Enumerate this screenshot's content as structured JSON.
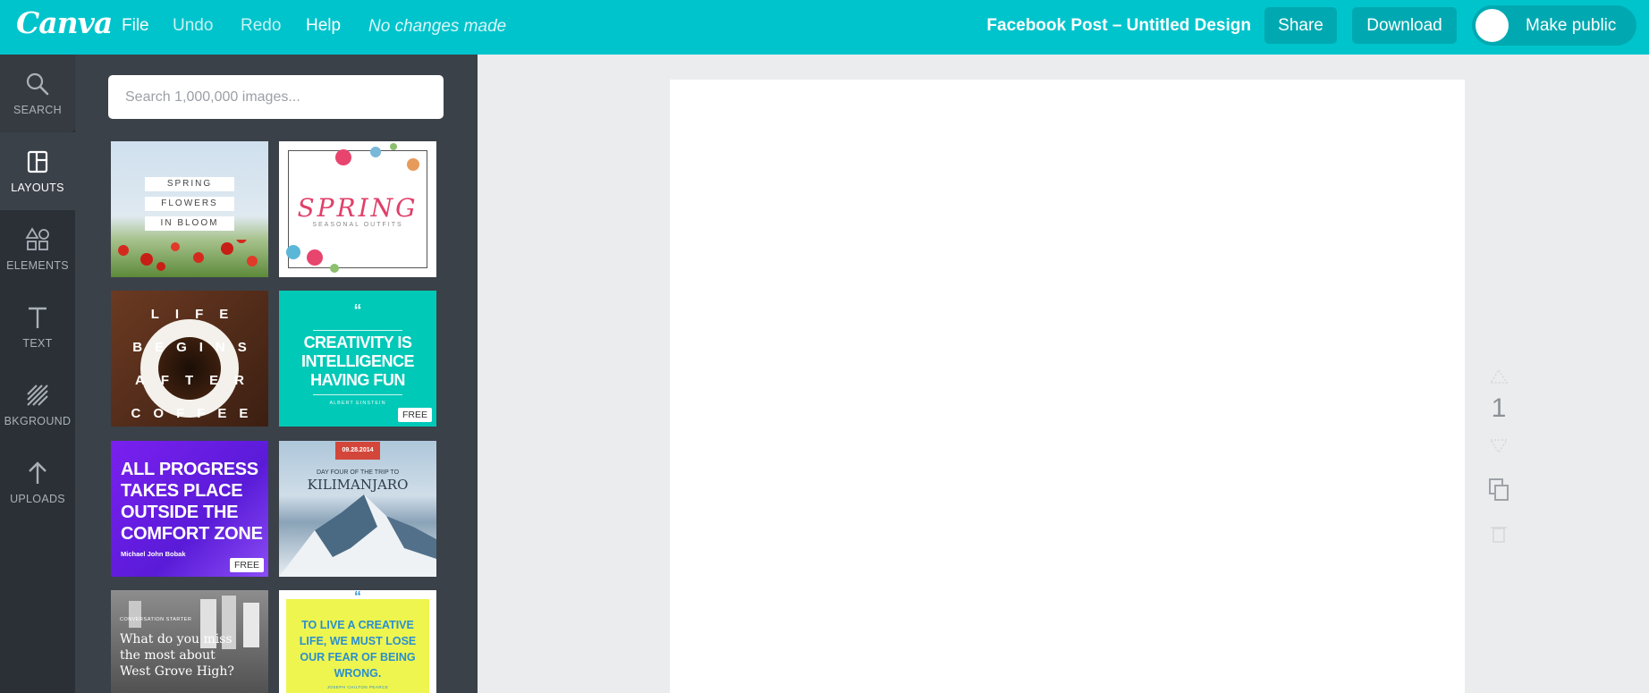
{
  "app": {
    "logo_text": "Canva"
  },
  "menu": {
    "file": "File",
    "undo": "Undo",
    "redo": "Redo",
    "help": "Help"
  },
  "status": "No changes made",
  "document_title": "Facebook Post – Untitled Design",
  "buttons": {
    "share": "Share",
    "download": "Download",
    "make_public": "Make public"
  },
  "sidebar": {
    "items": [
      {
        "label": "SEARCH",
        "icon": "search-icon"
      },
      {
        "label": "LAYOUTS",
        "icon": "layouts-icon",
        "selected": true
      },
      {
        "label": "ELEMENTS",
        "icon": "elements-icon"
      },
      {
        "label": "TEXT",
        "icon": "text-icon"
      },
      {
        "label": "BKGROUND",
        "icon": "background-icon"
      },
      {
        "label": "UPLOADS",
        "icon": "upload-icon"
      }
    ]
  },
  "panel": {
    "search_placeholder": "Search 1,000,000 images...",
    "layouts": [
      {
        "lines": [
          "SPRING",
          "FLOWERS",
          "IN BLOOM"
        ]
      },
      {
        "title": "SPRING",
        "subtitle": "SEASONAL OUTFITS"
      },
      {
        "letters": [
          "L",
          "I",
          "F",
          "E",
          "B",
          "E",
          "G",
          "I",
          "N",
          "S",
          "A",
          "F",
          "T",
          "E",
          "R",
          "C",
          "O",
          "F",
          "F",
          "E",
          "E"
        ]
      },
      {
        "quote_mark": "“",
        "lines": [
          "CREATIVITY IS",
          "INTELLIGENCE",
          "HAVING FUN"
        ],
        "author": "ALBERT EINSTEIN",
        "badge": "FREE"
      },
      {
        "lines": [
          "ALL PROGRESS",
          "TAKES PLACE",
          "OUTSIDE THE",
          "COMFORT ZONE"
        ],
        "author": "Michael John Bobak",
        "badge": "FREE"
      },
      {
        "date": "09.28.2014",
        "caption": "DAY FOUR OF THE TRIP TO",
        "title": "KILIMANJARO"
      },
      {
        "kicker": "CONVERSATION STARTER",
        "lines": [
          "What do you miss",
          "the most about",
          "West Grove High?"
        ]
      },
      {
        "quote_mark": "“",
        "lines": [
          "TO LIVE A CREATIVE",
          "LIFE, WE MUST LOSE",
          "OUR FEAR OF BEING",
          "WRONG."
        ],
        "author": "JOSEPH CHILTON PEARCE"
      }
    ]
  },
  "canvas": {
    "page_number": "1"
  }
}
